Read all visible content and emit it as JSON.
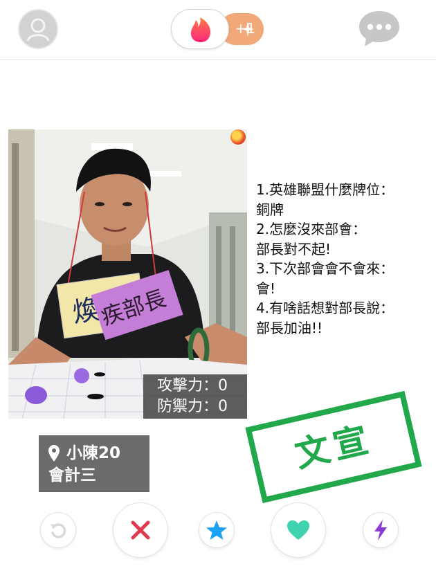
{
  "header": {
    "boost_count": "+1",
    "icons": {
      "profile": "profile-icon",
      "logo": "flame-logo-icon",
      "boost": "sparkle-icon",
      "messages": "chat-bubble-icon"
    }
  },
  "card": {
    "stats": [
      "攻擊力：0",
      "防禦力：0"
    ],
    "sign_text": [
      "煥",
      "疾部長"
    ],
    "qa": [
      "1.英雄聯盟什麼牌位：",
      "銅牌",
      "2.怎麼沒來部會：",
      "部長對不起!",
      "3.下次部會會不會來：",
      "會!",
      "4.有啥話想對部長說：",
      "部長加油!!"
    ],
    "name_age": "小陳20",
    "department": "會計三",
    "stamp": "文宣"
  },
  "actions": {
    "icons": [
      "rewind-icon",
      "nope-x-icon",
      "super-like-star-icon",
      "like-heart-icon",
      "boost-bolt-icon"
    ]
  },
  "colors": {
    "brand": "#fe3c72",
    "nope": "#e03a4f",
    "superlike": "#1da1f2",
    "like": "#3fd3b0",
    "boost": "#8b3bd6",
    "stamp": "#21a84a",
    "boost_pill": "#f2a97a"
  }
}
